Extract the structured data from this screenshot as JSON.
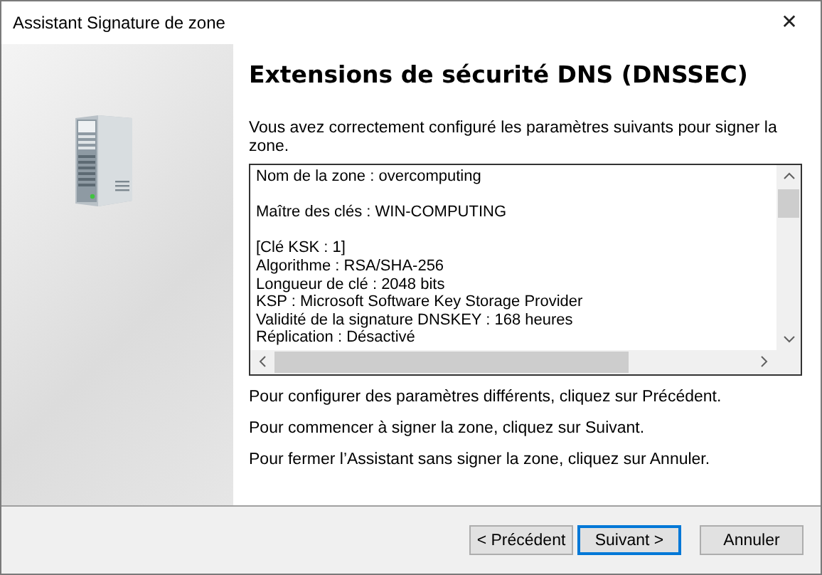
{
  "window": {
    "title": "Assistant Signature de zone",
    "close": "✕"
  },
  "heading": "Extensions de sécurité DNS (DNSSEC)",
  "intro": "Vous avez correctement configuré les paramètres suivants pour signer la zone.",
  "summary": [
    [
      "Nom de la zone : overcomputing"
    ],
    [
      "Maître des clés : WIN-COMPUTING"
    ],
    [
      "[Clé KSK : 1]",
      "Algorithme : RSA/SHA-256",
      "Longueur de clé : 2048 bits",
      "KSP : Microsoft Software Key Storage Provider",
      "Validité de la signature DNSKEY : 168 heures",
      "Réplication : Désactivé"
    ]
  ],
  "instructions": [
    "Pour configurer des paramètres différents, cliquez sur Précédent.",
    "Pour commencer à signer la zone, cliquez sur Suivant.",
    "Pour fermer l’Assistant sans signer la zone, cliquez sur Annuler."
  ],
  "buttons": [
    {
      "label": "< Précédent",
      "selected": false
    },
    {
      "label": "Suivant >",
      "selected": true
    },
    {
      "label": "Annuler",
      "selected": false
    }
  ]
}
